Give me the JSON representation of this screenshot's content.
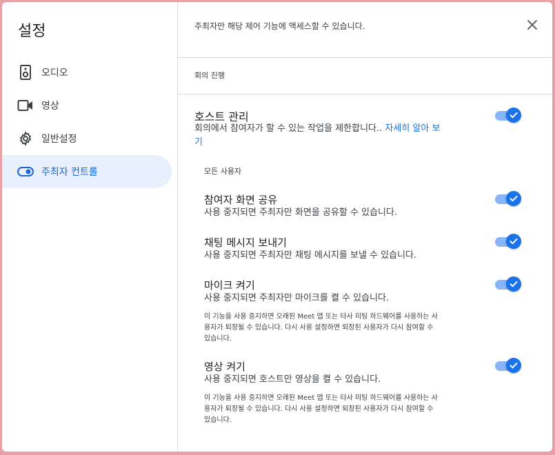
{
  "sidebar": {
    "title": "설정",
    "items": [
      {
        "label": "오디오",
        "icon": "speaker-icon"
      },
      {
        "label": "영상",
        "icon": "video-camera-icon"
      },
      {
        "label": "일반설정",
        "icon": "gear-icon"
      },
      {
        "label": "주최자 컨트롤",
        "icon": "toggle-icon",
        "active": true
      }
    ]
  },
  "main": {
    "header_text": "주최자만 해당 제어 기능에 액세스할 수 있습니다.",
    "section_label": "회의 진행",
    "host_management": {
      "title": "호스트 관리",
      "desc_line1_prefix": "회의에서 참여자가 할 수 있는 작업을 제한합니다.. ",
      "desc_line1_link": "자세히 알아 보",
      "desc_line2_link": "기",
      "enabled": true
    },
    "all_users_label": "모든 사용자",
    "settings": [
      {
        "title": "참여자 화면 공유",
        "desc": "사용 중지되면 주최자만 화면을 공유할 수 있습니다.",
        "enabled": true
      },
      {
        "title": "채팅 메시지 보내기",
        "desc": "사용 중지되면 주최자만 채팅 메시지를 보낼 수 있습니다.",
        "enabled": true
      },
      {
        "title": "마이크 켜기",
        "desc": "사용 중지되면 주최자만 마이크를 켤 수 있습니다.",
        "note": [
          "이 기능을 사용 중지하면 오래된 Meet 앱 또는 타사 미팅 하드웨어를 사용하는 사",
          "용자가 퇴장될 수 있습니다. 다시 사용 설정하면 퇴장된 사용자가 다시 참여할 수",
          "있습니다."
        ],
        "enabled": true
      },
      {
        "title": "영상 켜기",
        "desc": "사용 중지되면 호스트만 영상을 켤 수 있습니다.",
        "note": [
          "이 기능을 사용 중지하면 오래된 Meet 앱 또는 타사 미팅 하드웨어를 사용하는 사",
          "용자가 퇴장될 수 있습니다. 다시 사용 설정하면 퇴장된 사용자가 다시 참여할 수",
          "있습니다."
        ],
        "enabled": true
      }
    ]
  },
  "colors": {
    "accent": "#1a73e8",
    "active_bg": "#e8f0fe",
    "outer_bg": "#e9a0a6"
  }
}
